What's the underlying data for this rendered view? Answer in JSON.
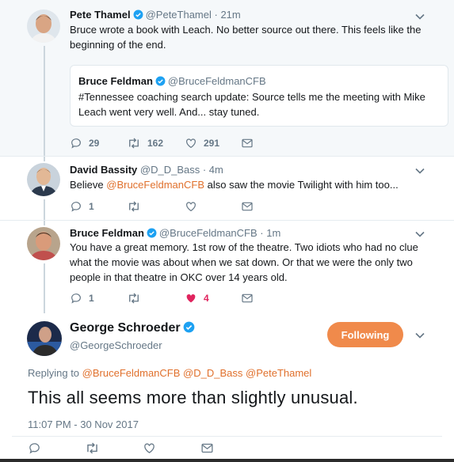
{
  "tweets": [
    {
      "name": "Pete Thamel",
      "handle": "@PeteThamel",
      "time": "· 21m",
      "text_line1": "Bruce wrote a book with Leach. No better source out there. This feels like the",
      "text_line2": "beginning of the end.",
      "quote": {
        "name": "Bruce Feldman",
        "handle": "@BruceFeldmanCFB",
        "text_line1": "#Tennessee coaching search update: Source tells me the meeting with Mike",
        "text_line2": "Leach went very well. And... stay tuned."
      },
      "replies": "29",
      "retweets": "162",
      "likes": "291"
    },
    {
      "name": "David Bassity",
      "handle": "@D_D_Bass",
      "time": "· 4m",
      "text_prefix": "Believe ",
      "mention": "@BruceFeldmanCFB",
      "text_suffix": " also saw the movie Twilight with him too...",
      "replies": "1",
      "retweets": "",
      "likes": ""
    },
    {
      "name": "Bruce Feldman",
      "handle": "@BruceFeldmanCFB",
      "time": "· 1m",
      "text_line1": "You have a great memory. 1st row of the theatre. Two idiots who had no clue",
      "text_line2": "what the movie was about when we sat down. Or that we were the only two",
      "text_line3": "people in that theatre in OKC over 14 years old.",
      "replies": "1",
      "retweets": "",
      "likes": "4"
    }
  ],
  "main_tweet": {
    "name": "George Schroeder",
    "handle": "@GeorgeSchroeder",
    "follow_label": "Following",
    "replying_to_label": "Replying to",
    "replying_to": [
      "@BruceFeldmanCFB",
      "@D_D_Bass",
      "@PeteThamel"
    ],
    "text": "This all seems more than slightly unusual.",
    "timestamp": "11:07 PM - 30 Nov 2017"
  },
  "colors": {
    "accent": "#f08a4b",
    "mention": "#e0702c",
    "like_active": "#e0245e",
    "verified": "#1da1f2"
  },
  "icons": [
    "reply-icon",
    "retweet-icon",
    "like-icon",
    "dm-icon",
    "verified-icon",
    "caret-down-icon"
  ]
}
